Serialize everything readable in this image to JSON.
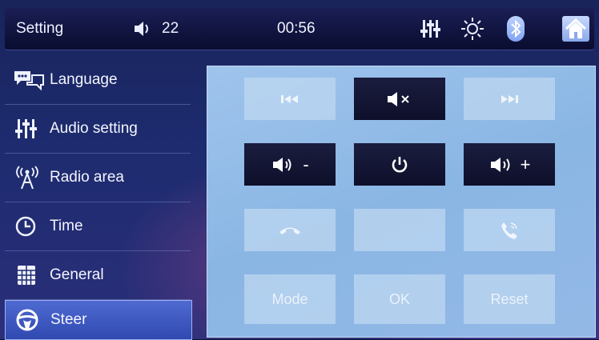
{
  "topbar": {
    "title": "Setting",
    "volume": "22",
    "time": "00:56",
    "icons": [
      "speaker-icon",
      "equalizer-icon",
      "brightness-icon",
      "bluetooth-icon",
      "home-icon"
    ]
  },
  "sidebar": {
    "items": [
      {
        "label": "Language",
        "icon": "speech-bubbles-icon"
      },
      {
        "label": "Audio setting",
        "icon": "equalizer-icon"
      },
      {
        "label": "Radio area",
        "icon": "antenna-icon"
      },
      {
        "label": "Time",
        "icon": "clock-icon"
      },
      {
        "label": "General",
        "icon": "grid-icon"
      },
      {
        "label": "Steer",
        "icon": "steering-wheel-icon"
      }
    ],
    "active": "Steer"
  },
  "steer_grid": {
    "buttons": [
      {
        "icon": "previous-track-icon",
        "state": "inactive"
      },
      {
        "icon": "mute-icon",
        "state": "active"
      },
      {
        "icon": "next-track-icon",
        "state": "inactive"
      },
      {
        "icon": "volume-down-icon",
        "label": "-",
        "state": "active"
      },
      {
        "icon": "power-icon",
        "state": "active"
      },
      {
        "icon": "volume-up-icon",
        "label": "+",
        "state": "active"
      },
      {
        "icon": "hang-up-icon",
        "state": "inactive"
      },
      {
        "icon": "",
        "state": "inactive"
      },
      {
        "icon": "answer-call-icon",
        "state": "inactive"
      },
      {
        "label": "Mode",
        "state": "inactive"
      },
      {
        "label": "OK",
        "state": "inactive"
      },
      {
        "label": "Reset",
        "state": "inactive"
      }
    ]
  },
  "colors": {
    "active_button": "#131533",
    "inactive_button": "#bcd6f0",
    "panel": "#94bbe8",
    "sidebar_active": "#3f5bc0"
  }
}
